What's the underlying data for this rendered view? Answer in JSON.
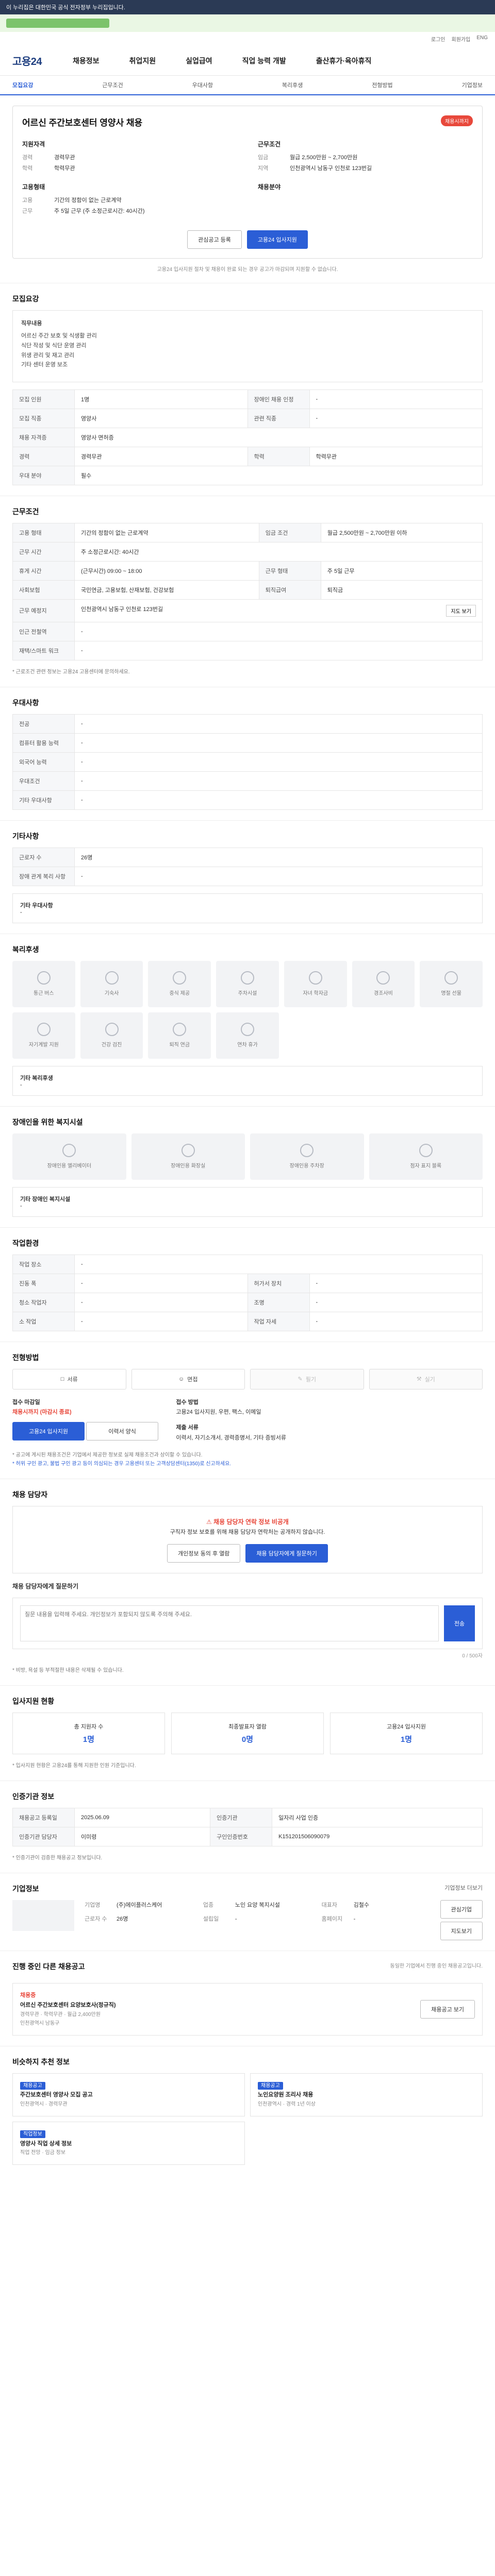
{
  "topbar": {
    "text": "이 누리집은 대한민국 공식 전자정부 누리집입니다."
  },
  "mini_nav": [
    "로그인",
    "회원가입",
    "ENG"
  ],
  "header": {
    "logo": "고용24",
    "gnb": [
      "채용정보",
      "취업지원",
      "실업급여",
      "직업 능력 개발",
      "출산휴가·육아휴직"
    ]
  },
  "subtabs": [
    "모집요강",
    "근무조건",
    "우대사항",
    "복리후생",
    "전형방법",
    "기업정보"
  ],
  "job": {
    "title": "어르신 주간보호센터 영양사 채용",
    "badge": "채용시까지",
    "left_heading": "지원자격",
    "left": [
      {
        "k": "경력",
        "v": "경력무관"
      },
      {
        "k": "학력",
        "v": "학력무관"
      }
    ],
    "right_heading": "근무조건",
    "right": [
      {
        "k": "임금",
        "v": "월급 2,500만원 ~ 2,700만원"
      },
      {
        "k": "지역",
        "v": "인천광역시 남동구 인천로 123번길"
      }
    ],
    "left2_heading": "고용형태",
    "left2": [
      {
        "k": "고용",
        "v": "기간의 정함이 없는 근로계약"
      },
      {
        "k": "근무",
        "v": "주 5일 근무 (주 소정근로시간: 40시간)"
      }
    ],
    "right2_heading": "채용분야",
    "btn_scrap": "관심공고 등록",
    "btn_apply": "고용24 입사지원",
    "notice": "고용24 입사지원 절차 및 채용이 완료 되는 경우 공고가 마감되며 지원할 수 없습니다."
  },
  "recruit": {
    "title": "모집요강",
    "desc_heading": "직무내용",
    "desc_lines": [
      "어르신 주간 보호 및 식생활 관리",
      "식단 작성 및 식단 운영 관리",
      "위생 관리 및 재고 관리",
      "기타 센터 운영 보조"
    ],
    "rows": [
      {
        "k": "모집 인원",
        "v": "1명",
        "k2": "장애인 채용 인정",
        "v2": "-"
      },
      {
        "k": "모집 직종",
        "v": "영양사",
        "k2": "관련 직종",
        "v2": "-"
      },
      {
        "k": "채용 자격증",
        "v": "영양사 면허증",
        "k2": "",
        "v2": ""
      },
      {
        "k": "경력",
        "v": "경력무관",
        "k2": "학력",
        "v2": "학력무관"
      },
      {
        "k": "우대 분야",
        "v": "필수",
        "k2": "",
        "v2": ""
      }
    ]
  },
  "condition": {
    "title": "근무조건",
    "rows": [
      {
        "k": "고용 형태",
        "v": "기간의 정함이 없는 근로계약",
        "k2": "임금 조건",
        "v2": "월급 2,500만원 ~ 2,700만원 이하"
      },
      {
        "k": "근무 시간",
        "v": "주 소정근로시간: 40시간",
        "k2": "",
        "v2": ""
      },
      {
        "k": "휴게 시간",
        "v": "(근무시간) 09:00 ~ 18:00",
        "k2": "근무 형태",
        "v2": "주 5일 근무"
      },
      {
        "k": "사회보험",
        "v": "국민연금, 고용보험, 산재보험, 건강보험",
        "k2": "퇴직급여",
        "v2": "퇴직금"
      },
      {
        "k": "근무 예정지",
        "v": "인천광역시 남동구 인천로 123번길",
        "k2": "",
        "v2": ""
      },
      {
        "k": "인근 전철역",
        "v": "-",
        "k2": "",
        "v2": ""
      },
      {
        "k": "재택/스마트 워크",
        "v": "-",
        "k2": "",
        "v2": ""
      }
    ],
    "map_btn": "지도 보기",
    "note": "* 근로조건 관련 정보는 고용24 고용센터에 문의하세요."
  },
  "pref": {
    "title": "우대사항",
    "rows": [
      {
        "k": "전공",
        "v": "-"
      },
      {
        "k": "컴퓨터 활용 능력",
        "v": "-"
      },
      {
        "k": "외국어 능력",
        "v": "-"
      },
      {
        "k": "우대조건",
        "v": "-"
      },
      {
        "k": "기타 우대사항",
        "v": "-"
      }
    ]
  },
  "etc": {
    "title": "기타사항",
    "rows": [
      {
        "k": "근로자 수",
        "v": "26명"
      },
      {
        "k": "장애 관계 복리 사항",
        "v": "-"
      }
    ],
    "memo_label": "기타 우대사항",
    "memo_value": "-"
  },
  "benefit": {
    "title": "복리후생",
    "items": [
      "통근 버스",
      "기숙사",
      "중식 제공",
      "주차시설",
      "자녀 학자금",
      "경조사비",
      "명절 선물",
      "자기계발 지원",
      "건강 검진",
      "퇴직 연금",
      "연차 휴가"
    ],
    "memo_label": "기타 복리후생",
    "memo_value": "-"
  },
  "disability": {
    "title": "장애인을 위한 복지시설",
    "items": [
      "장애인용 엘리베이터",
      "장애인용 화장실",
      "장애인용 주차장",
      "점자 표지 블록"
    ],
    "memo_label": "기타 장애인 복지시설",
    "memo_value": "-"
  },
  "environment": {
    "title": "작업환경",
    "rows": [
      {
        "k": "작업 장소",
        "v": "-",
        "k2": "",
        "v2": ""
      },
      {
        "k": "진동 폭",
        "v": "-",
        "k2": "허가서 장치",
        "v2": "-"
      },
      {
        "k": "청소 작업자",
        "v": "-",
        "k2": "조명",
        "v2": "-"
      },
      {
        "k": "소 작업",
        "v": "-",
        "k2": "작업 자세",
        "v2": "-"
      }
    ]
  },
  "apply": {
    "title": "전형방법",
    "cards": [
      "서류",
      "면접",
      "필기",
      "실기"
    ],
    "deadline_label": "접수 마감일",
    "deadline": "채용시까지 (마감시 종료)",
    "btn_apply": "고용24 입사지원",
    "btn_doc": "이력서 양식",
    "method_label": "접수 방법",
    "method": "고용24 입사지원, 우편, 팩스, 이메일",
    "docs_label": "제출 서류",
    "docs": "이력서, 자기소개서, 경력증명서, 기타 증빙서류",
    "fine1": "* 공고에 게시된 채용조건은 기업에서 제공한 정보로 실제 채용조건과 상이할 수 있습니다.",
    "fine2": "* 허위 구인 광고, 불법 구인 광고 등이 의심되는 경우 고용센터 또는 고객상담센터(1350)로 신고하세요."
  },
  "qa": {
    "title": "채용 담당자",
    "alert_title": "채용 담당자 연락 정보 비공개",
    "alert_text": "구직자 정보 보호를 위해 채용 담당자 연락처는 공개하지 않습니다.",
    "btn1": "개인정보 동의 후 열람",
    "btn2": "채용 담당자에게 질문하기",
    "box_label": "채용 담당자에게 질문하기",
    "placeholder": "질문 내용을 입력해 주세요. 개인정보가 포함되지 않도록 주의해 주세요.",
    "submit": "전송",
    "count": "0 / 500자",
    "fine": "* 비방, 욕설 등 부적절한 내용은 삭제될 수 있습니다."
  },
  "stats": {
    "title": "입사지원 현황",
    "items": [
      {
        "label": "총 지원자 수",
        "value": "1명"
      },
      {
        "label": "최종발표자 열람",
        "value": "0명"
      },
      {
        "label": "고용24 입사지원",
        "value": "1명"
      }
    ],
    "note": "* 입사지원 현황은 고용24를 통해 지원한 인원 기준입니다."
  },
  "register": {
    "title": "인증기관 정보",
    "rows": [
      {
        "k": "채용공고 등록일",
        "v": "2025.06.09",
        "k2": "인증기관",
        "v2": "일자리 사업 인증"
      },
      {
        "k": "인증기관 담당자",
        "v": "이미령",
        "k2": "구인인증번호",
        "v2": "K151201506090079"
      }
    ],
    "fine": "* 인증기관이 검증한 채용공고 정보입니다."
  },
  "company": {
    "title": "기업정보",
    "more": "기업정보 더보기",
    "cols": [
      {
        "k": "기업명",
        "v": "(주)에이플러스케어"
      },
      {
        "k": "업종",
        "v": "노인 요양 복지시설"
      },
      {
        "k": "대표자",
        "v": "김철수"
      },
      {
        "k": "근로자 수",
        "v": "26명"
      },
      {
        "k": "설립일",
        "v": "-"
      },
      {
        "k": "홈페이지",
        "v": "-"
      }
    ],
    "btn_scrap": "관심기업",
    "btn_map": "지도보기"
  },
  "recommend": {
    "title": "진행 중인 다른 채용공고",
    "subtitle": "동일한 기업에서 진행 중인 채용공고입니다.",
    "card": {
      "tag": "채용중",
      "title": "어르신 주간보호센터 요양보호사(정규직)",
      "detail1": "경력무관 · 학력무관 · 월급 2,400만원",
      "detail2": "인천광역시 남동구",
      "btn": "채용공고 보기"
    }
  },
  "related": {
    "title": "비슷하지 추천 정보",
    "cards": [
      {
        "tag": "채용공고",
        "title": "주간보호센터 영양사 모집 공고",
        "meta": "인천광역시 · 경력무관"
      },
      {
        "tag": "채용공고",
        "title": "노인요양원 조리사 채용",
        "meta": "인천광역시 · 경력 1년 이상"
      },
      {
        "tag": "직업정보",
        "title": "영양사 직업 상세 정보",
        "meta": "직업 전망 · 임금 정보"
      }
    ]
  }
}
